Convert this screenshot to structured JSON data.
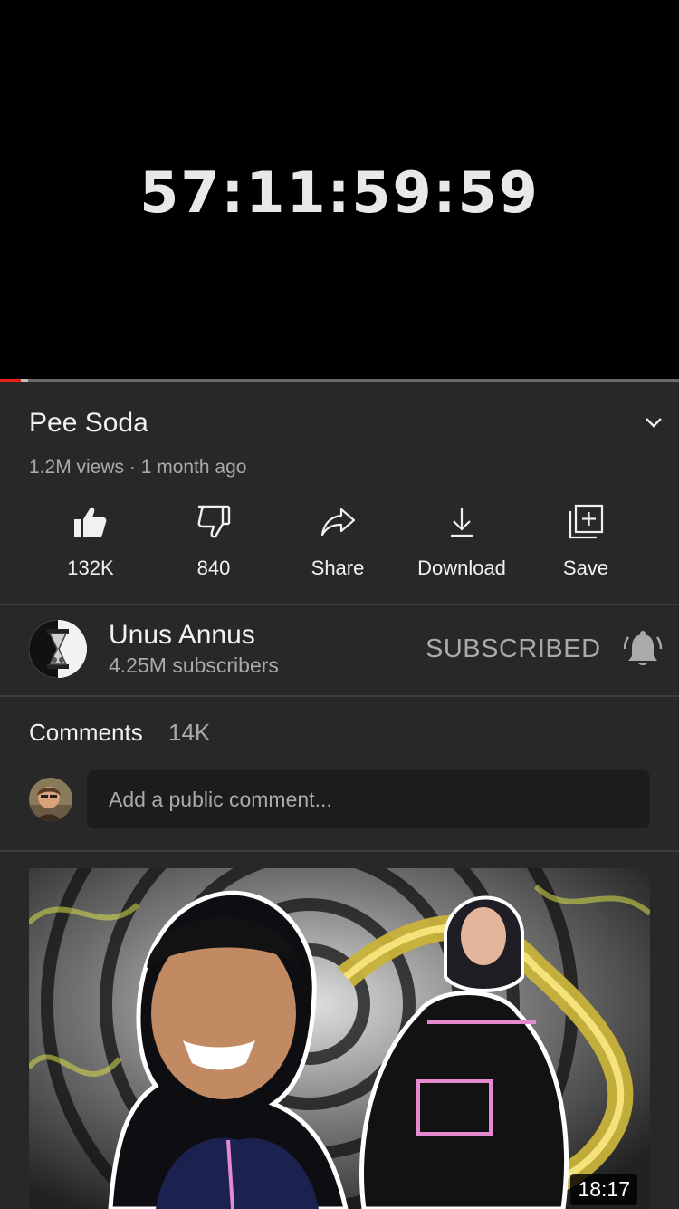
{
  "player": {
    "countdown": "57:11:59:59",
    "progress_fraction": 0.03
  },
  "video": {
    "title": "Pee Soda",
    "meta": "1.2M views · 1 month ago"
  },
  "actions": [
    {
      "icon": "thumbs-up-icon",
      "label": "132K"
    },
    {
      "icon": "thumbs-down-icon",
      "label": "840"
    },
    {
      "icon": "share-icon",
      "label": "Share"
    },
    {
      "icon": "download-icon",
      "label": "Download"
    },
    {
      "icon": "save-to-playlist-icon",
      "label": "Save"
    }
  ],
  "channel": {
    "name": "Unus Annus",
    "subscribers": "4.25M subscribers",
    "subscribe_label": "SUBSCRIBED"
  },
  "comments": {
    "label": "Comments",
    "count": "14K",
    "placeholder": "Add a public comment..."
  },
  "next_video": {
    "duration": "18:17"
  },
  "colors": {
    "background": "#282828",
    "player_bg": "#000000",
    "progress": "#e62117",
    "secondary_text": "#aaaaaa"
  }
}
